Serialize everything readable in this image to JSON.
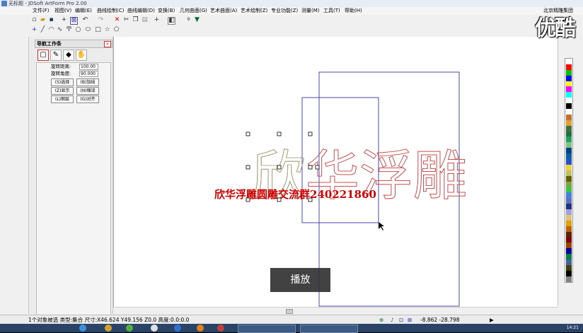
{
  "window": {
    "title": "无标题 - JDSoft ArtForm Pro 2.00"
  },
  "menu": {
    "items": [
      "文件(F)",
      "视图(V)",
      "编辑(E)",
      "曲线绘制(C)",
      "曲线编辑(D)",
      "变换(B)",
      "几何曲面(G)",
      "艺术曲面(A)",
      "艺术绘制(Z)",
      "专业功能(Z)",
      "测量(M)",
      "工具(T)",
      "帮助(H)"
    ],
    "right_text": "北京精雕集团"
  },
  "video_overlay": {
    "logo": "优酷",
    "play_label": "播放"
  },
  "nav_panel": {
    "title": "导航工作条",
    "fields": [
      {
        "label": "旋转距离:",
        "value": "100.00"
      },
      {
        "label": "旋转角度:",
        "value": "90.000"
      }
    ],
    "buttons": [
      [
        "(S)选择",
        "(B)加线"
      ],
      [
        "(Z)显示",
        "(N)缩译"
      ],
      [
        "(L)图层",
        "(G)对齐"
      ]
    ]
  },
  "canvas": {
    "outline_text": "欣华浮雕",
    "red_text": "欣华浮雕圆雕交流群240221860",
    "colors": {
      "outline_green": "#a8b48a",
      "outline_red": "#c85050",
      "red_text": "#d20000",
      "rect_blue": "#4a4aa8"
    }
  },
  "status": {
    "left": "1个对象被选  类型:集合  尺寸:X46.624 Y49.156 Z0.0  高度:0.0:0.0",
    "coords": "-8.862  -28.798"
  },
  "palette": {
    "colors": [
      "#ffffff",
      "#ff0000",
      "#00c000",
      "#0000ff",
      "#ffff00",
      "#ff00ff",
      "#00ffff",
      "#ffffff",
      "#000000",
      "#ffffff",
      "#c07030",
      "#e0a030",
      "#407040",
      "#207040",
      "#20a060",
      "#80c080",
      "#004080",
      "#0060a0",
      "#2050d0",
      "#f0d040",
      "#c0c060",
      "#606000",
      "#80a040",
      "#40c040",
      "#4080e0",
      "#6070c0",
      "#203080",
      "#a0a0e0",
      "#e0c080",
      "#e0a000",
      "#c06000",
      "#602000",
      "#800000",
      "#a04000",
      "#0000a0",
      "#008040",
      "#4060a0",
      "#404000",
      "#000000",
      "#808080"
    ]
  },
  "taskbar": {
    "clock": "14:21"
  }
}
